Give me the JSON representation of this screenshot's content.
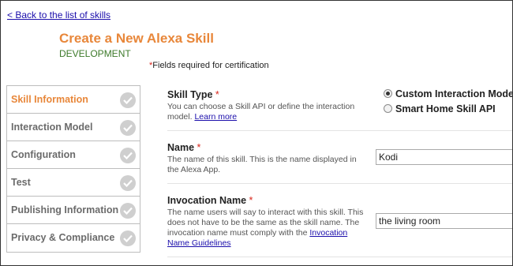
{
  "nav": {
    "back_link": "< Back to the list of skills"
  },
  "header": {
    "title": "Create a New Alexa Skill",
    "environment": "DEVELOPMENT",
    "required_star": "*",
    "required_note": "Fields required for certification"
  },
  "sidebar": {
    "items": [
      {
        "label": "Skill Information",
        "active": true
      },
      {
        "label": "Interaction Model",
        "active": false
      },
      {
        "label": "Configuration",
        "active": false
      },
      {
        "label": "Test",
        "active": false
      },
      {
        "label": "Publishing Information",
        "active": false
      },
      {
        "label": "Privacy & Compliance",
        "active": false
      }
    ]
  },
  "skill_type": {
    "label": "Skill Type",
    "star": "*",
    "description": "You can choose a Skill API or define the interaction model.",
    "learn_more": "Learn more",
    "options": [
      {
        "label": "Custom Interaction Model",
        "selected": true
      },
      {
        "label": "Smart Home Skill API",
        "selected": false
      }
    ]
  },
  "name_field": {
    "label": "Name",
    "star": "*",
    "description_line1": "The name of this skill. This is the name displayed in",
    "description_line2": "the Alexa App.",
    "value": "Kodi"
  },
  "invocation_field": {
    "label": "Invocation Name",
    "star": "*",
    "description_line1": "The name users will say to interact with this skill. This",
    "description_line2": "does not have to be the same as the skill name. The",
    "description_line3": "invocation name must comply with the",
    "guidelines_link_line1": "Invocation",
    "guidelines_link_line2": "Name Guidelines",
    "value": "the living room"
  },
  "colors": {
    "accent": "#e8873a",
    "environment": "#3d7a2a",
    "link": "#1a0dab",
    "required": "#d9261c"
  }
}
